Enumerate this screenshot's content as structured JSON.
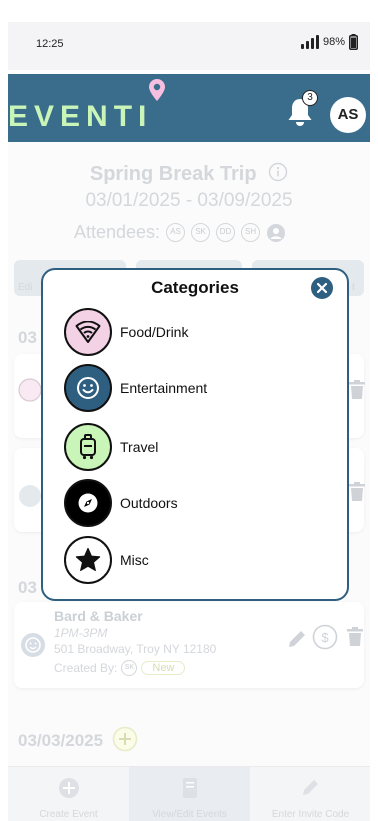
{
  "status": {
    "time": "12:25",
    "battery": "98%"
  },
  "header": {
    "logo": "EVENTI",
    "notif_count": "3",
    "avatar": "AS"
  },
  "trip": {
    "title": "Spring Break Trip",
    "dates": "03/01/2025 - 03/09/2025",
    "attendees_label": "Attendees:",
    "attendees": [
      "AS",
      "SK",
      "DD",
      "SH"
    ]
  },
  "bg_dates": {
    "d1": "03",
    "d2": "03",
    "d3": "03/03/2025"
  },
  "bg_tab_fragments": {
    "left": "Edi",
    "right": "t"
  },
  "bg_event": {
    "name": "Bard & Baker",
    "time": "1PM-3PM",
    "address": "501 Broadway, Troy NY 12180",
    "created_label": "Created By:",
    "creator": "SK",
    "badge": "New"
  },
  "bottom_nav": [
    {
      "label": "Create Event"
    },
    {
      "label": "View/Edit Events"
    },
    {
      "label": "Enter Invite Code"
    }
  ],
  "modal": {
    "title": "Categories",
    "categories": [
      {
        "label": "Food/Drink",
        "icon": "wifi-icon",
        "color": "#f3d2e6"
      },
      {
        "label": "Entertainment",
        "icon": "smiley-icon",
        "color": "#2f5f80"
      },
      {
        "label": "Travel",
        "icon": "luggage-icon",
        "color": "#c9f5b8"
      },
      {
        "label": "Outdoors",
        "icon": "compass-icon",
        "color": "#000000"
      },
      {
        "label": "Misc",
        "icon": "star-icon",
        "color": "#ffffff"
      }
    ]
  },
  "colors": {
    "brand": "#3a6d8c",
    "accent": "#c9f5b8",
    "modal_border": "#2f5f80"
  }
}
